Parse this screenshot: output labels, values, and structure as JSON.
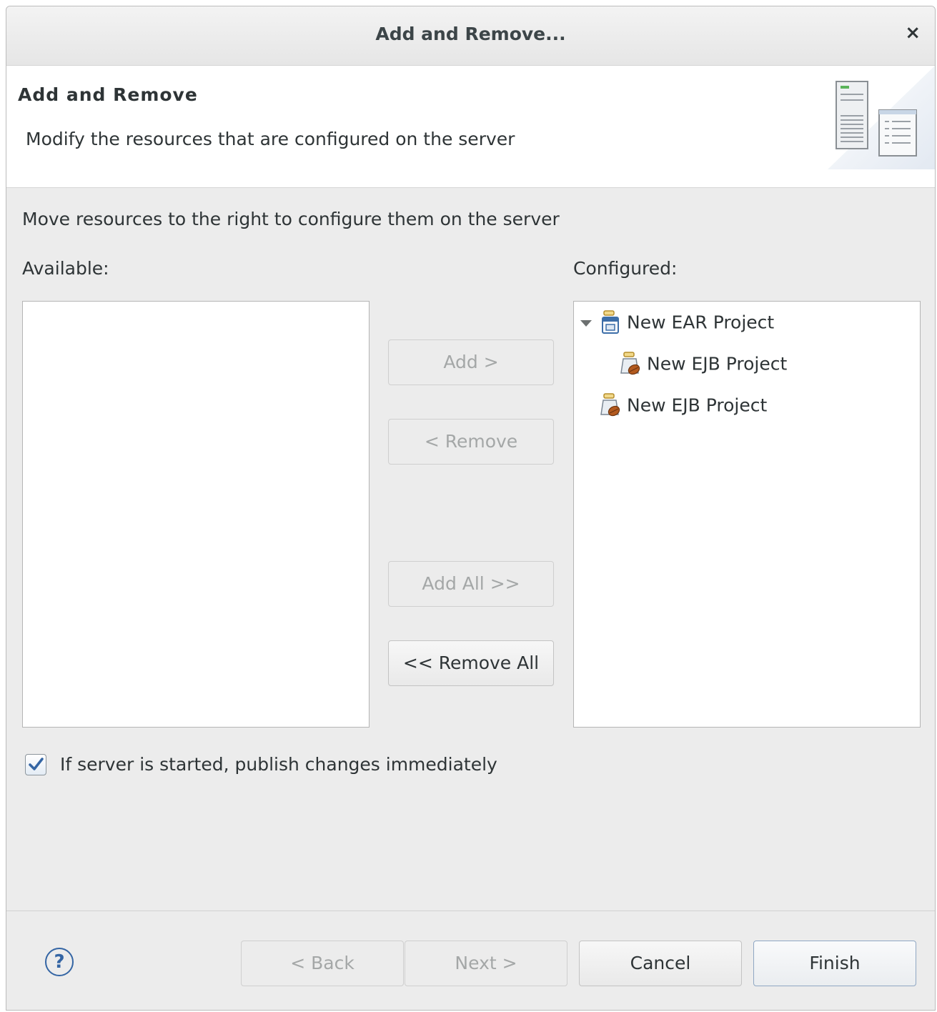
{
  "window": {
    "title": "Add and Remove...",
    "close_glyph": "×"
  },
  "banner": {
    "title": "Add and Remove",
    "description": "Modify the resources that are configured on the server",
    "icon": "server-wizard-banner-icon"
  },
  "instruction": "Move resources to the right to configure them on the server",
  "available": {
    "label": "Available:",
    "items": []
  },
  "configured": {
    "label": "Configured:",
    "items": [
      {
        "label": "New EAR Project",
        "icon": "ear-project-icon",
        "expanded": true,
        "level": 0
      },
      {
        "label": "New EJB Project",
        "icon": "ejb-project-icon",
        "level": 1
      },
      {
        "label": "New EJB Project",
        "icon": "ejb-project-icon",
        "level": 0
      }
    ]
  },
  "buttons": {
    "add": "Add >",
    "remove": "< Remove",
    "add_all": "Add All >>",
    "remove_all": "<< Remove All"
  },
  "publish_checkbox": {
    "label": "If server is started, publish changes immediately",
    "checked": true
  },
  "footer": {
    "help_glyph": "?",
    "back": "< Back",
    "next": "Next >",
    "cancel": "Cancel",
    "finish": "Finish"
  },
  "colors": {
    "accent": "#3465a4",
    "window_bg": "#ececec",
    "disabled_text": "#a4a7a7"
  }
}
